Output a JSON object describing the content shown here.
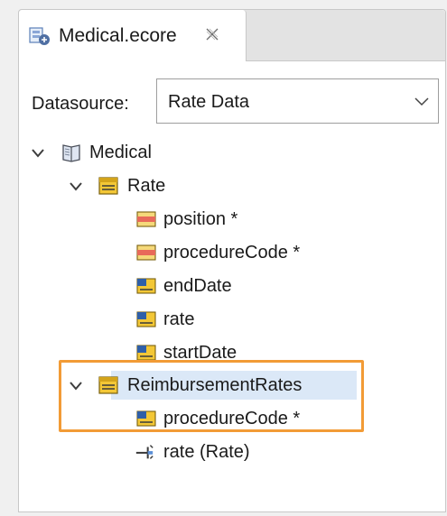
{
  "tab": {
    "label": "Medical.ecore",
    "icon": "ecore-model-icon",
    "close_icon": "close-tab-icon"
  },
  "datasource": {
    "label": "Datasource:",
    "value": "Rate Data"
  },
  "tree": {
    "root": {
      "label": "Medical",
      "icon": "package-icon"
    },
    "rate_class": {
      "label": "Rate",
      "icon": "class-icon"
    },
    "rate_attributes": [
      {
        "label": "position *",
        "icon": "key-attribute-icon"
      },
      {
        "label": "procedureCode *",
        "icon": "key-attribute-icon"
      },
      {
        "label": "endDate",
        "icon": "attribute-icon"
      },
      {
        "label": "rate",
        "icon": "attribute-icon"
      },
      {
        "label": "startDate",
        "icon": "attribute-icon"
      }
    ],
    "reimb_class": {
      "label": "ReimbursementRates",
      "icon": "class-icon"
    },
    "reimb_children": [
      {
        "label": "procedureCode *",
        "icon": "attribute-icon"
      },
      {
        "label": "rate (Rate)",
        "icon": "reference-icon"
      }
    ]
  },
  "colors": {
    "highlight": "#f29b36",
    "selection": "#dbe8f7",
    "class_yellow": "#f3c736",
    "key_red": "#e86a5a"
  }
}
